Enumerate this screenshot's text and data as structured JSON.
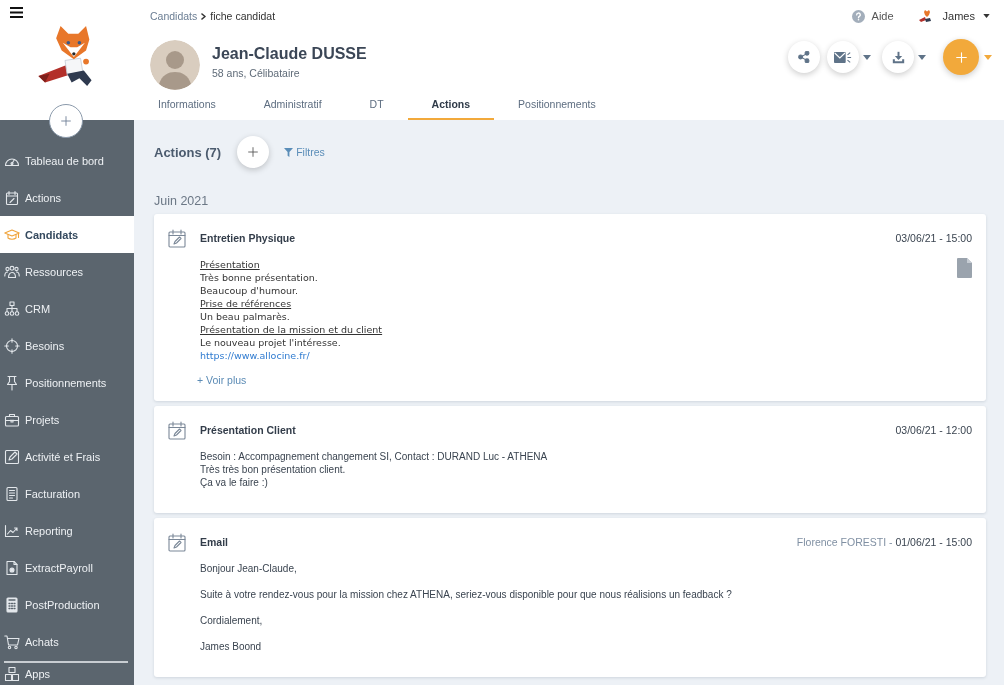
{
  "sidebar": {
    "items": [
      {
        "label": "Tableau de bord",
        "selected": false
      },
      {
        "label": "Actions",
        "selected": false
      },
      {
        "label": "Candidats",
        "selected": true
      },
      {
        "label": "Ressources",
        "selected": false
      },
      {
        "label": "CRM",
        "selected": false
      },
      {
        "label": "Besoins",
        "selected": false
      },
      {
        "label": "Positionnements",
        "selected": false
      },
      {
        "label": "Projets",
        "selected": false
      },
      {
        "label": "Activité et Frais",
        "selected": false
      },
      {
        "label": "Facturation",
        "selected": false
      },
      {
        "label": "Reporting",
        "selected": false
      },
      {
        "label": "ExtractPayroll",
        "selected": false
      },
      {
        "label": "PostProduction",
        "selected": false
      },
      {
        "label": "Achats",
        "selected": false
      }
    ],
    "footer": [
      {
        "label": "Apps",
        "selected": false
      }
    ]
  },
  "breadcrumb": [
    {
      "label": "Candidats"
    },
    {
      "label": "fiche candidat"
    }
  ],
  "help": {
    "label": "Aide"
  },
  "user": {
    "name": "James"
  },
  "candidate": {
    "name": "Jean-Claude DUSSE",
    "details": "58 ans, Célibataire"
  },
  "tabs": [
    {
      "label": "Informations",
      "selected": false
    },
    {
      "label": "Administratif",
      "selected": false
    },
    {
      "label": "DT",
      "selected": false
    },
    {
      "label": "Actions",
      "selected": true
    },
    {
      "label": "Positionnements",
      "selected": false
    }
  ],
  "actions": {
    "title": "Actions (7)",
    "filter_label": "Filtres",
    "month": "Juin 2021"
  },
  "cards": [
    {
      "kind": "rich_note",
      "title": "Entretien Physique",
      "date": "03/06/21 - 15:00",
      "attachment": true,
      "lines": [
        {
          "kind": "heading",
          "text": "Présentation"
        },
        {
          "kind": "text",
          "text": "Très bonne présentation."
        },
        {
          "kind": "text",
          "text": "Beaucoup d'humour."
        },
        {
          "kind": "heading",
          "text": "Prise de références"
        },
        {
          "kind": "text",
          "text": "Un beau palmarès."
        },
        {
          "kind": "heading",
          "text": "Présentation de la mission et du client"
        },
        {
          "kind": "text",
          "text": "Le nouveau projet l'intéresse."
        },
        {
          "kind": "link",
          "text": "https://www.allocine.fr/"
        }
      ],
      "more_link": "+ Voir plus"
    },
    {
      "kind": "note",
      "title": "Présentation Client",
      "date": "03/06/21 - 12:00",
      "attachment": false,
      "lines": [
        "Besoin : Accompagnement changement SI, Contact : DURAND Luc - ATHENA",
        "Très très bon présentation client.",
        "Ça va le faire :)"
      ]
    },
    {
      "kind": "email",
      "title": "Email",
      "author": "Florence FORESTI -",
      "date": "01/06/21 - 15:00",
      "attachment": false,
      "lines": [
        "Bonjour Jean-Claude,",
        "Suite à votre rendez-vous pour la mission chez ATHENA, seriez-vous disponible pour que nous réalisions un feadback ?",
        "Cordialement,",
        "James Boond"
      ]
    }
  ]
}
